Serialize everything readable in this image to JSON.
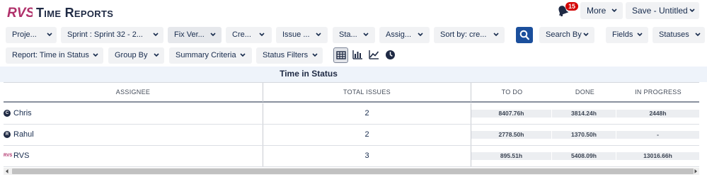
{
  "app": {
    "logo_text": "RVS",
    "title": "Time Reports",
    "notification_count": "15",
    "more_label": "More",
    "save_label": "Save - Untitled..."
  },
  "filters": {
    "project": "Proje...",
    "sprint": "Sprint : Sprint 32 - 2...",
    "fix_version": "Fix Ver...",
    "created": "Cre...",
    "issue_type": "Issue ...",
    "status": "Sta...",
    "assignee": "Assig...",
    "sort_by": "Sort by: cre...",
    "search_by": "Search By",
    "fields": "Fields",
    "statuses": "Statuses"
  },
  "report_bar": {
    "report": "Report: Time in Status",
    "group_by": "Group By",
    "summary_criteria": "Summary Criteria",
    "status_filters": "Status Filters"
  },
  "view_icons": [
    "grid-view-icon",
    "bar-chart-icon",
    "line-chart-icon",
    "clock-icon"
  ],
  "table": {
    "caption": "Time in Status",
    "columns": {
      "assignee": "ASSIGNEE",
      "total_issues": "TOTAL ISSUES",
      "to_do": "TO DO",
      "done": "DONE",
      "in_progress": "IN PROGRESS"
    },
    "rows": [
      {
        "avatar": "C",
        "name": "Chris",
        "total": "2",
        "to_do": "8407.76h",
        "done": "3814.24h",
        "in_progress": "2448h"
      },
      {
        "avatar": "R",
        "name": "Rahul",
        "total": "2",
        "to_do": "2778.50h",
        "done": "1370.50h",
        "in_progress": "-"
      },
      {
        "avatar": "RVS",
        "name": "RVS",
        "total": "3",
        "to_do": "895.51h",
        "done": "5408.09h",
        "in_progress": "13016.66h"
      }
    ]
  },
  "colors": {
    "primary": "#1b4f9c",
    "badge": "#d40000",
    "logo": "#b0306a",
    "header_band": "#eef3fa"
  }
}
